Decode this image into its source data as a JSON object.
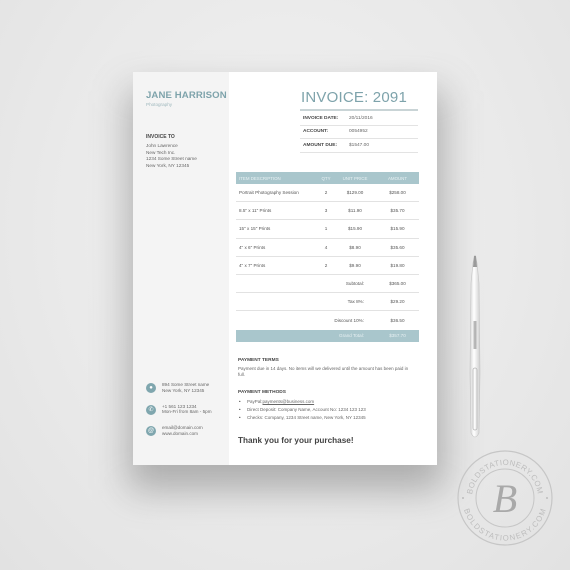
{
  "sender": {
    "name": "JANE HARRISON",
    "tagline": "Photography"
  },
  "invoice_to": {
    "title": "INVOICE TO",
    "lines": [
      "John Lawrence",
      "New Tech Inc.",
      "1234 Some Street name",
      "New York, NY 12345"
    ]
  },
  "contacts": [
    {
      "icon": "location-pin-icon",
      "glyph": "●",
      "lines": [
        "894 Some Street name",
        "New York, NY 12345"
      ]
    },
    {
      "icon": "phone-icon",
      "glyph": "✆",
      "lines": [
        "+1 561 123 1234",
        "Mon-Fri from 8am - 5pm"
      ]
    },
    {
      "icon": "at-email-icon",
      "glyph": "@",
      "lines": [
        "email@domain.com",
        "www.domain.com"
      ]
    }
  ],
  "invoice": {
    "title": "INVOICE: 2091",
    "meta": [
      {
        "label": "INVOICE DATE:",
        "value": "20/11/2016"
      },
      {
        "label": "ACCOUNT:",
        "value": "0054952"
      },
      {
        "label": "AMOUNT DUE:",
        "value": "$1547.00"
      }
    ]
  },
  "items_table": {
    "headers": [
      "ITEM DESCRIPTION",
      "QTY",
      "UNIT PRICE",
      "AMOUNT"
    ],
    "rows": [
      [
        "Portrait Photography Session",
        "2",
        "$129.00",
        "$258.00"
      ],
      [
        "8.5\" x 11\" Prints",
        "3",
        "$11.90",
        "$35.70"
      ],
      [
        "15\" x 15\" Prints",
        "1",
        "$15.90",
        "$15.90"
      ],
      [
        "4\" x 6\" Prints",
        "4",
        "$8.90",
        "$35.60"
      ],
      [
        "4\" x 7\" Prints",
        "2",
        "$9.90",
        "$19.80"
      ]
    ],
    "summary": [
      {
        "label": "Subtotal:",
        "value": "$365.00"
      },
      {
        "label": "Tax 8%:",
        "value": "$29.20"
      },
      {
        "label": "Discount 10%:",
        "value": "$36.50"
      }
    ],
    "grand_total": {
      "label": "Grand Total:",
      "value": "$357.70"
    }
  },
  "payment_terms": {
    "title": "PAYMENT TERMS",
    "text": "Payment due in 14 days. No items will we delivered until the amount has been paid in full."
  },
  "payment_methods": {
    "title": "PAYMENT METHODS",
    "items": [
      {
        "label": "PayPal: ",
        "link": "payments@business.com"
      },
      {
        "label": "Direct Deposit: Company Name, Account No: 1234 123 123",
        "link": ""
      },
      {
        "label": "Checks: Company, 1234 Street name, New York, NY 12345",
        "link": ""
      }
    ]
  },
  "thanks": "Thank you for your purchase!",
  "watermark": {
    "text_top": "BOLDSTATIONERY.COM",
    "text_bottom": "BOLDSTATIONERY.COM",
    "monogram": "B"
  },
  "colors": {
    "accent": "#7ea3ab",
    "table_header": "#a9c6cc",
    "sidebar_bg": "#f4f4f4"
  }
}
